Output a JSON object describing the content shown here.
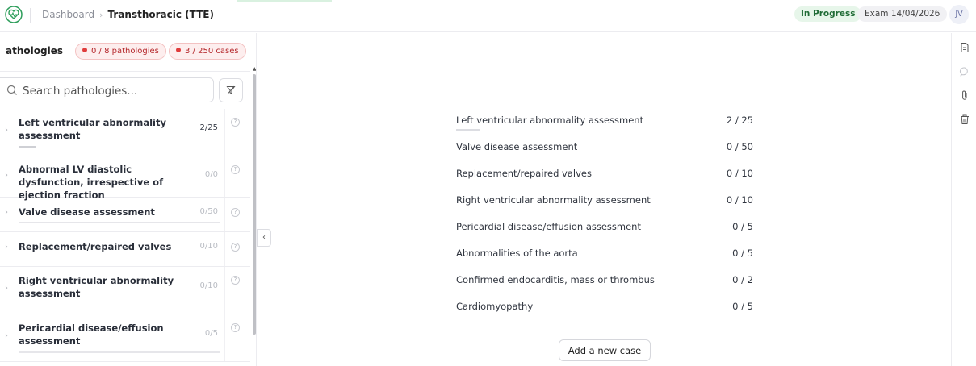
{
  "header": {
    "breadcrumb_home": "Dashboard",
    "breadcrumb_separator": "›",
    "breadcrumb_current": "Transthoracic (TTE)",
    "status": "In Progress",
    "exam_label": "Exam 14/04/2026",
    "user_initials": "JV",
    "accent_color": "#2e9e5b"
  },
  "left_panel": {
    "title": "athologies",
    "pathologies_badge": "0 / 8 pathologies",
    "cases_badge": "3 / 250 cases",
    "search_placeholder": "Search pathologies...",
    "items": [
      {
        "label": "Left ventricular abnormality assessment",
        "count": "2/25"
      },
      {
        "label": "Abnormal LV diastolic dysfunction, irrespective of ejection fraction",
        "count": "0/0"
      },
      {
        "label": "Valve disease assessment",
        "count": "0/50"
      },
      {
        "label": "Replacement/repaired valves",
        "count": "0/10"
      },
      {
        "label": "Right ventricular abnormality assessment",
        "count": "0/10"
      },
      {
        "label": "Pericardial disease/effusion assessment",
        "count": "0/5"
      }
    ]
  },
  "collapse_glyph": "‹",
  "summary": {
    "rows": [
      {
        "name": "Left ventricular abnormality assessment",
        "value": "2 / 25"
      },
      {
        "name": "Valve disease assessment",
        "value": "0 / 50"
      },
      {
        "name": "Replacement/repaired valves",
        "value": "0 / 10"
      },
      {
        "name": "Right ventricular abnormality assessment",
        "value": "0 / 10"
      },
      {
        "name": "Pericardial disease/effusion assessment",
        "value": "0 / 5"
      },
      {
        "name": "Abnormalities of the aorta",
        "value": "0 / 5"
      },
      {
        "name": "Confirmed endocarditis, mass or thrombus",
        "value": "0 / 2"
      },
      {
        "name": "Cardiomyopathy",
        "value": "0 / 5"
      }
    ],
    "add_case_label": "Add a new case"
  },
  "right_rail": {
    "icons": [
      "document-icon",
      "comment-icon",
      "paperclip-icon",
      "trash-icon"
    ]
  }
}
